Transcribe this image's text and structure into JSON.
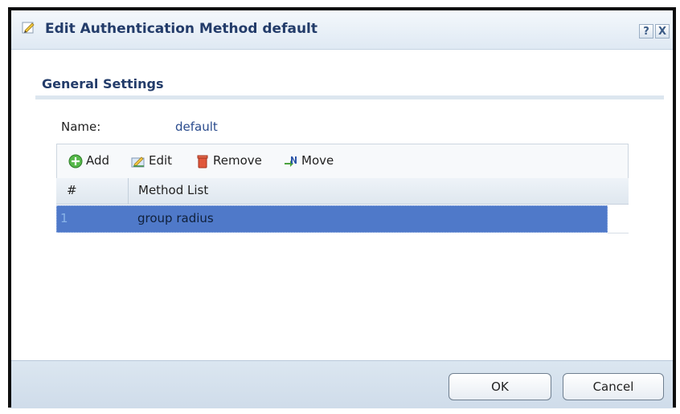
{
  "dialog": {
    "title": "Edit Authentication Method default",
    "title_icon": "edit-pencil-icon",
    "help_label": "?",
    "close_label": "X"
  },
  "section": {
    "title": "General Settings"
  },
  "name_field": {
    "label": "Name:",
    "value": "default"
  },
  "toolbar": {
    "add_label": "Add",
    "edit_label": "Edit",
    "remove_label": "Remove",
    "move_label": "Move"
  },
  "table": {
    "columns": [
      "#",
      "Method List"
    ],
    "rows": [
      {
        "index": "1",
        "method": "group radius"
      }
    ]
  },
  "footer": {
    "ok_label": "OK",
    "cancel_label": "Cancel"
  },
  "colors": {
    "title_text": "#233c6a",
    "selected_row": "#4f79c9",
    "footer_bg": "#d5e1ed"
  }
}
